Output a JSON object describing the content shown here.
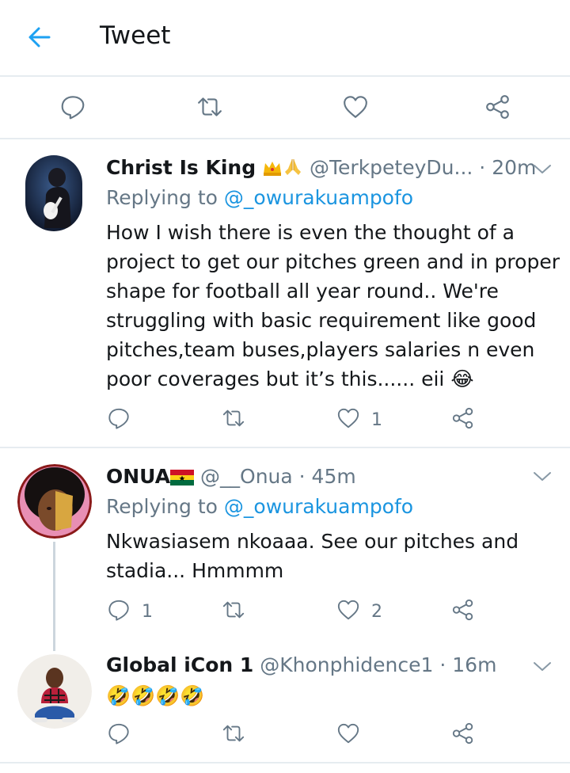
{
  "header": {
    "title": "Tweet"
  },
  "tweets": [
    {
      "display_name": "Christ Is King",
      "handle": "@TerkpeteyDu...",
      "time": "· 20m",
      "replying_prefix": "Replying to",
      "replying_to": "@_owurakuampofo",
      "text": "How I wish there is even the thought of a project to get our pitches green and in proper shape for football all year round.. We're struggling with basic requirement like good pitches,team buses,players salaries n even poor coverages but it’s this...... eii 😂",
      "reply_count": "",
      "like_count": "1"
    },
    {
      "display_name": "ONUA",
      "handle": "@__Onua",
      "time": "· 45m",
      "replying_prefix": "Replying to",
      "replying_to": "@_owurakuampofo",
      "text": "Nkwasiasem nkoaaa. See our pitches and stadia... Hmmmm",
      "reply_count": "1",
      "like_count": "2"
    },
    {
      "display_name": "Global iCon 1",
      "handle": "@Khonphidence1",
      "time": "· 16m",
      "text": "🤣🤣🤣🤣",
      "reply_count": "",
      "like_count": ""
    }
  ],
  "colors": {
    "accent": "#1da1f2",
    "link": "#1b95e0",
    "icon_gray": "#657786",
    "divider": "#e6ecf0"
  }
}
